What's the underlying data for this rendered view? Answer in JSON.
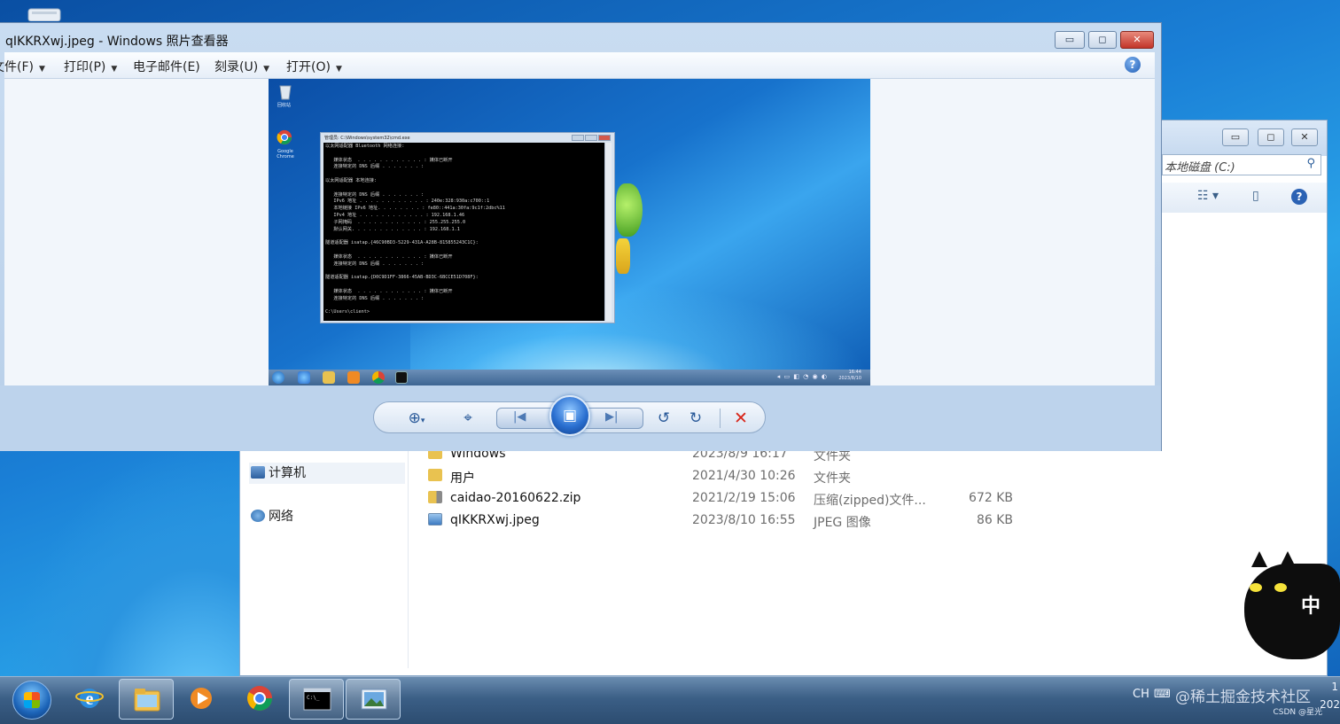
{
  "viewer": {
    "title": "qIKKRXwj.jpeg - Windows 照片查看器",
    "menu": [
      {
        "label": "文件(F)",
        "has_arrow": true
      },
      {
        "label": "打印(P)",
        "has_arrow": true
      },
      {
        "label": "电子邮件(E)",
        "has_arrow": false
      },
      {
        "label": "刻录(U)",
        "has_arrow": true
      },
      {
        "label": "打开(O)",
        "has_arrow": true
      }
    ],
    "help_label": "?",
    "window_buttons": {
      "minimize": "▭",
      "maximize": "◻",
      "close": "✕"
    },
    "controls": {
      "zoom": "zoom-icon",
      "actual_size": "fit-icon",
      "previous": "previous-icon",
      "slideshow": "slideshow-icon",
      "next": "next-icon",
      "rotate_ccw": "rotate-left-icon",
      "rotate_cw": "rotate-right-icon",
      "delete": "delete-icon"
    },
    "photo": {
      "desktop_icons": [
        "回收站",
        "Google Chrome"
      ],
      "cmd_title": "管理员: C:\\Windows\\system32\\cmd.exe",
      "cmd_lines": [
        "以太网适配器 Bluetooth 网络连接:",
        "",
        "   媒体状态  . . . . . . . . . . . . : 媒体已断开",
        "   连接特定的 DNS 后缀 . . . . . . . :",
        "",
        "以太网适配器 本地连接:",
        "",
        "   连接特定的 DNS 后缀 . . . . . . . :",
        "   IPv6 地址 . . . . . . . . . . . . : 240e:328:930a:c700::1",
        "   本地链接 IPv6 地址. . . . . . . . : fe80::441a:30fa:9c1f:2dbc%11",
        "   IPv4 地址 . . . . . . . . . . . . : 192.168.1.46",
        "   子网掩码  . . . . . . . . . . . . : 255.255.255.0",
        "   默认网关. . . . . . . . . . . . . : 192.168.1.1",
        "",
        "隧道适配器 isatap.{46C90BD3-5229-431A-A28B-815855243C1C}:",
        "",
        "   媒体状态  . . . . . . . . . . . . : 媒体已断开",
        "   连接特定的 DNS 后缀 . . . . . . . :",
        "",
        "隧道适配器 isatap.{D0C9D1FF-3866-45AB-BD3C-6BCCE51D708F}:",
        "",
        "   媒体状态  . . . . . . . . . . . . : 媒体已断开",
        "   连接特定的 DNS 后缀 . . . . . . . :",
        "",
        "C:\\Users\\client>"
      ],
      "clock": [
        "16:44",
        "2023/8/10"
      ]
    }
  },
  "explorer": {
    "address": "本地磁盘 (C:)",
    "nav": [
      {
        "label": "计算机",
        "selected": true
      },
      {
        "label": "网络",
        "selected": false
      }
    ],
    "files": [
      {
        "name": "Windows",
        "date": "2023/8/9 16:17",
        "type": "文件夹",
        "size": "",
        "icon": "folder-icon"
      },
      {
        "name": "用户",
        "date": "2021/4/30 10:26",
        "type": "文件夹",
        "size": "",
        "icon": "folder-icon"
      },
      {
        "name": "caidao-20160622.zip",
        "date": "2021/2/19 15:06",
        "type": "压缩(zipped)文件...",
        "size": "672 KB",
        "icon": "zip-folder-icon"
      },
      {
        "name": "qIKKRXwj.jpeg",
        "date": "2023/8/10 16:55",
        "type": "JPEG 图像",
        "size": "86 KB",
        "icon": "image-file-icon"
      }
    ]
  },
  "taskbar": {
    "apps": [
      "internet-explorer-icon",
      "explorer-icon",
      "media-player-icon",
      "chrome-icon",
      "cmd-icon",
      "photo-viewer-icon"
    ],
    "tray_lang": "CH",
    "watermark": "@稀土掘金技术社区",
    "csdn": "CSDN @星光",
    "year": "202",
    "time_partial": "1"
  },
  "cat": {
    "label": "中"
  },
  "colors": {
    "accent": "#2a6fd0",
    "close": "#c2352a",
    "delete": "#d8261a"
  }
}
